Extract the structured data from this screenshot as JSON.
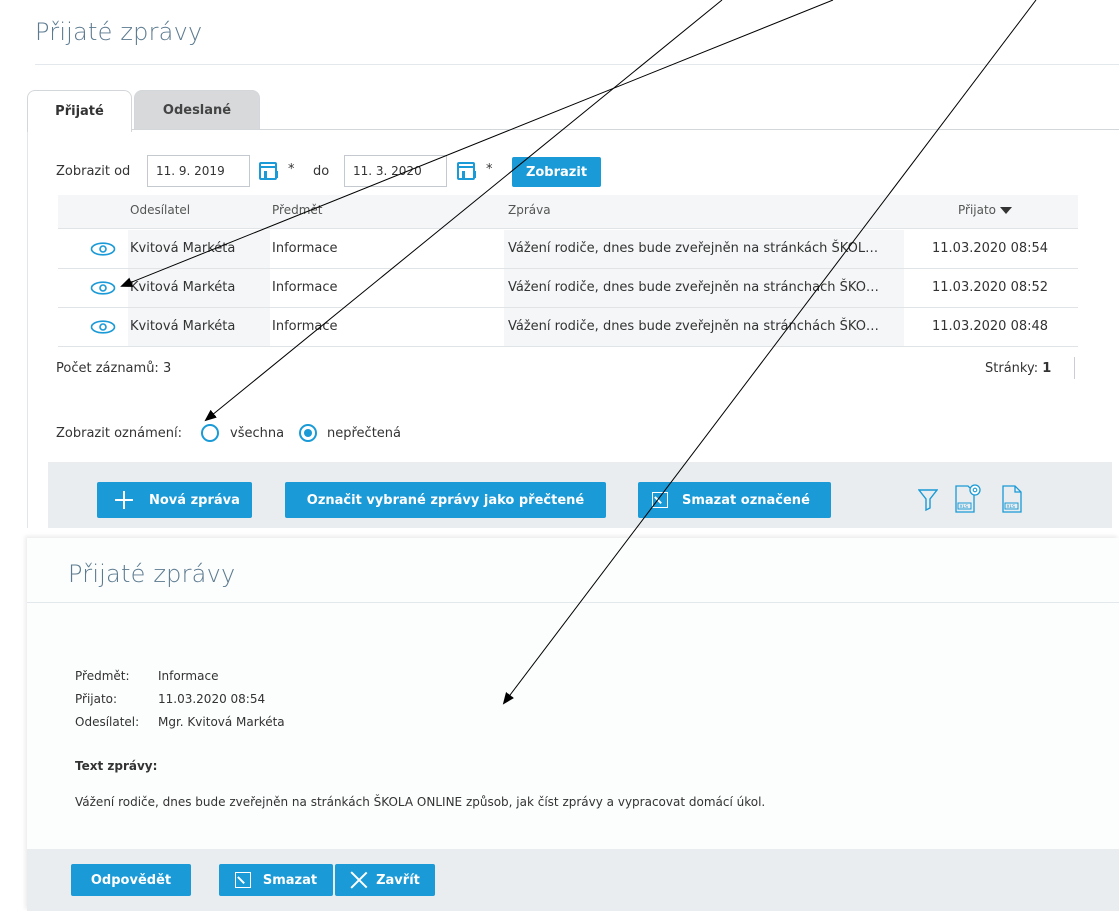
{
  "list_view": {
    "title": "Přijaté zprávy",
    "tabs": [
      {
        "label": "Přijaté",
        "active": true
      },
      {
        "label": "Odeslané",
        "active": false
      }
    ],
    "filter": {
      "from_label": "Zobrazit od",
      "from_value": "11. 9. 2019",
      "asterisk": "*",
      "to_label": "do",
      "to_value": "11. 3. 2020",
      "submit_label": "Zobrazit"
    },
    "table": {
      "headers": {
        "sender": "Odesílatel",
        "subject": "Předmět",
        "message": "Zpráva",
        "received": "Přijato"
      },
      "rows": [
        {
          "sender": "Kvitová Markéta",
          "subject": "Informace",
          "message": "Vážení rodiče, dnes bude zveřejněn na stránkách ŠKOL…",
          "received": "11.03.2020 08:54"
        },
        {
          "sender": "Kvitová Markéta",
          "subject": "Informace",
          "message": "Vážení rodiče, dnes bude zveřejněn na stránchach ŠKO…",
          "received": "11.03.2020 08:52"
        },
        {
          "sender": "Kvitová Markéta",
          "subject": "Informace",
          "message": "Vážení rodiče, dnes bude zveřejněn na stránchách ŠKO…",
          "received": "11.03.2020 08:48"
        }
      ]
    },
    "record_count": "Počet záznamů: 3",
    "pages_label": "Stránky:",
    "pages_value": "1",
    "notice_filter": {
      "label": "Zobrazit oznámení:",
      "options": [
        {
          "label": "všechna",
          "checked": false
        },
        {
          "label": "nepřečtená",
          "checked": true
        }
      ]
    },
    "toolbar": {
      "new_message": "Nová zpráva",
      "mark_read": "Označit vybrané zprávy jako přečtené",
      "delete_marked": "Smazat označené",
      "icons": [
        "filter-icon",
        "xls-settings-icon",
        "xls-export-icon"
      ]
    }
  },
  "detail_view": {
    "title": "Přijaté zprávy",
    "fields": [
      {
        "label": "Předmět:",
        "value": "Informace"
      },
      {
        "label": "Přijato:",
        "value": "11.03.2020 08:54"
      },
      {
        "label": "Odesílatel:",
        "value": "Mgr. Kvitová Markéta"
      }
    ],
    "text_heading": "Text zprávy:",
    "text": "Vážení rodiče, dnes bude zveřejněn na stránkách ŠKOLA ONLINE způsob, jak číst zprávy a vypracovat domácí úkol.",
    "actions": {
      "reply": "Odpovědět",
      "delete": "Smazat",
      "close": "Zavřít"
    }
  },
  "colors": {
    "accent": "#1a9ad6",
    "title": "#5b7a8f",
    "toolbar_bg": "#e9edef",
    "row_bg": "#f4f6f7"
  }
}
